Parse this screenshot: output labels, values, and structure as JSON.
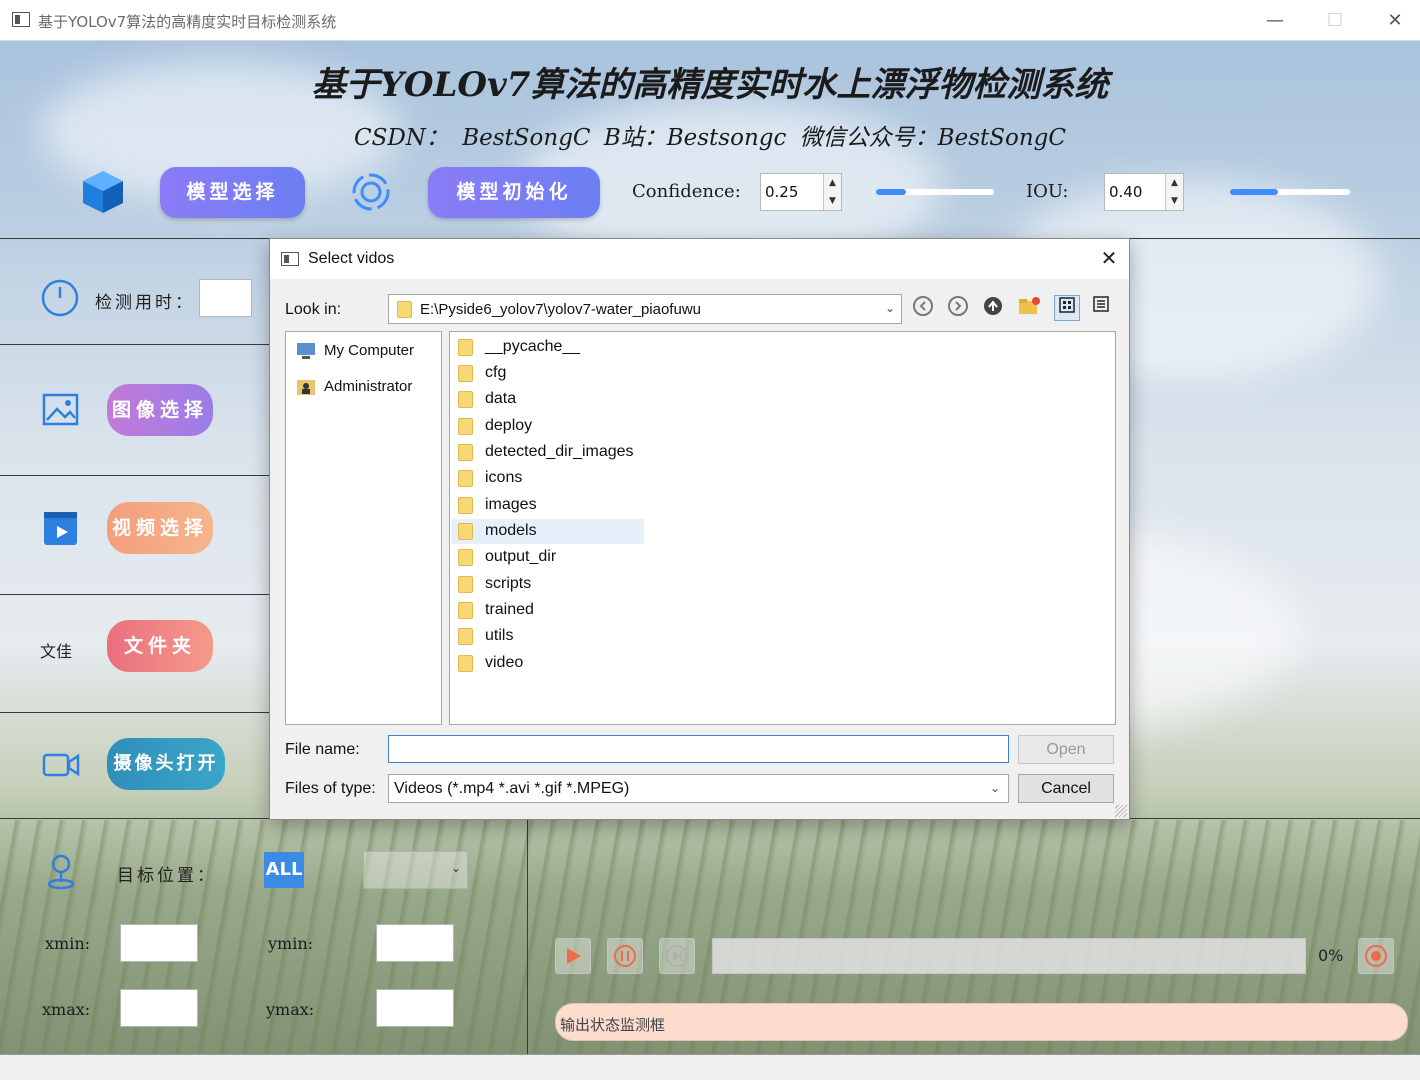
{
  "window": {
    "title": "基于YOLOv7算法的高精度实时目标检测系统",
    "minimize": "—",
    "maximize": "☐",
    "close": "✕"
  },
  "header": {
    "title": "基于YOLOv7算法的高精度实时水上漂浮物检测系统",
    "subtitle": "CSDN： BestSongC B站：Bestsongc 微信公众号：BestSongC"
  },
  "toolbar": {
    "model_select_label": "模型选择",
    "model_init_label": "模型初始化",
    "confidence_label": "Confidence:",
    "confidence_value": "0.25",
    "confidence_level": 0.25,
    "iou_label": "IOU:",
    "iou_value": "0.40",
    "iou_level": 0.4
  },
  "left_panel": {
    "detect_time_label": "检测用时：",
    "image_select_label": "图像选择",
    "video_select_label": "视频选择",
    "folder_side_label": "文佳",
    "folder_label": "文件夹",
    "camera_label": "摄像头打开",
    "target_position_label": "目标位置：",
    "all_badge": "ALL",
    "xmin_label": "xmin:",
    "ymin_label": "ymin:",
    "xmax_label": "xmax:",
    "ymax_label": "ymax:"
  },
  "player": {
    "progress_percent": "0%",
    "progress_level": 0,
    "status_placeholder": "输出状态监测框"
  },
  "dialog": {
    "title": "Select vidos",
    "close": "✕",
    "look_in_label": "Look in:",
    "path": "E:\\Pyside6_yolov7\\yolov7-water_piaofuwu",
    "sidebar": [
      "My Computer",
      "Administrator"
    ],
    "folders": [
      "__pycache__",
      "cfg",
      "data",
      "deploy",
      "detected_dir_images",
      "icons",
      "images",
      "models",
      "output_dir",
      "scripts",
      "trained",
      "utils",
      "video"
    ],
    "selected_folder": "models",
    "file_name_label": "File name:",
    "file_name_value": "",
    "files_of_type_label": "Files of type:",
    "files_of_type_value": "Videos (*.mp4 *.avi *.gif *.MPEG)",
    "open_label": "Open",
    "cancel_label": "Cancel"
  },
  "colors": {
    "accent": "#3f8cff",
    "model_btn": "#7a7ef5",
    "status_box": "#fbdccd",
    "selection": "#e5f0fb"
  }
}
